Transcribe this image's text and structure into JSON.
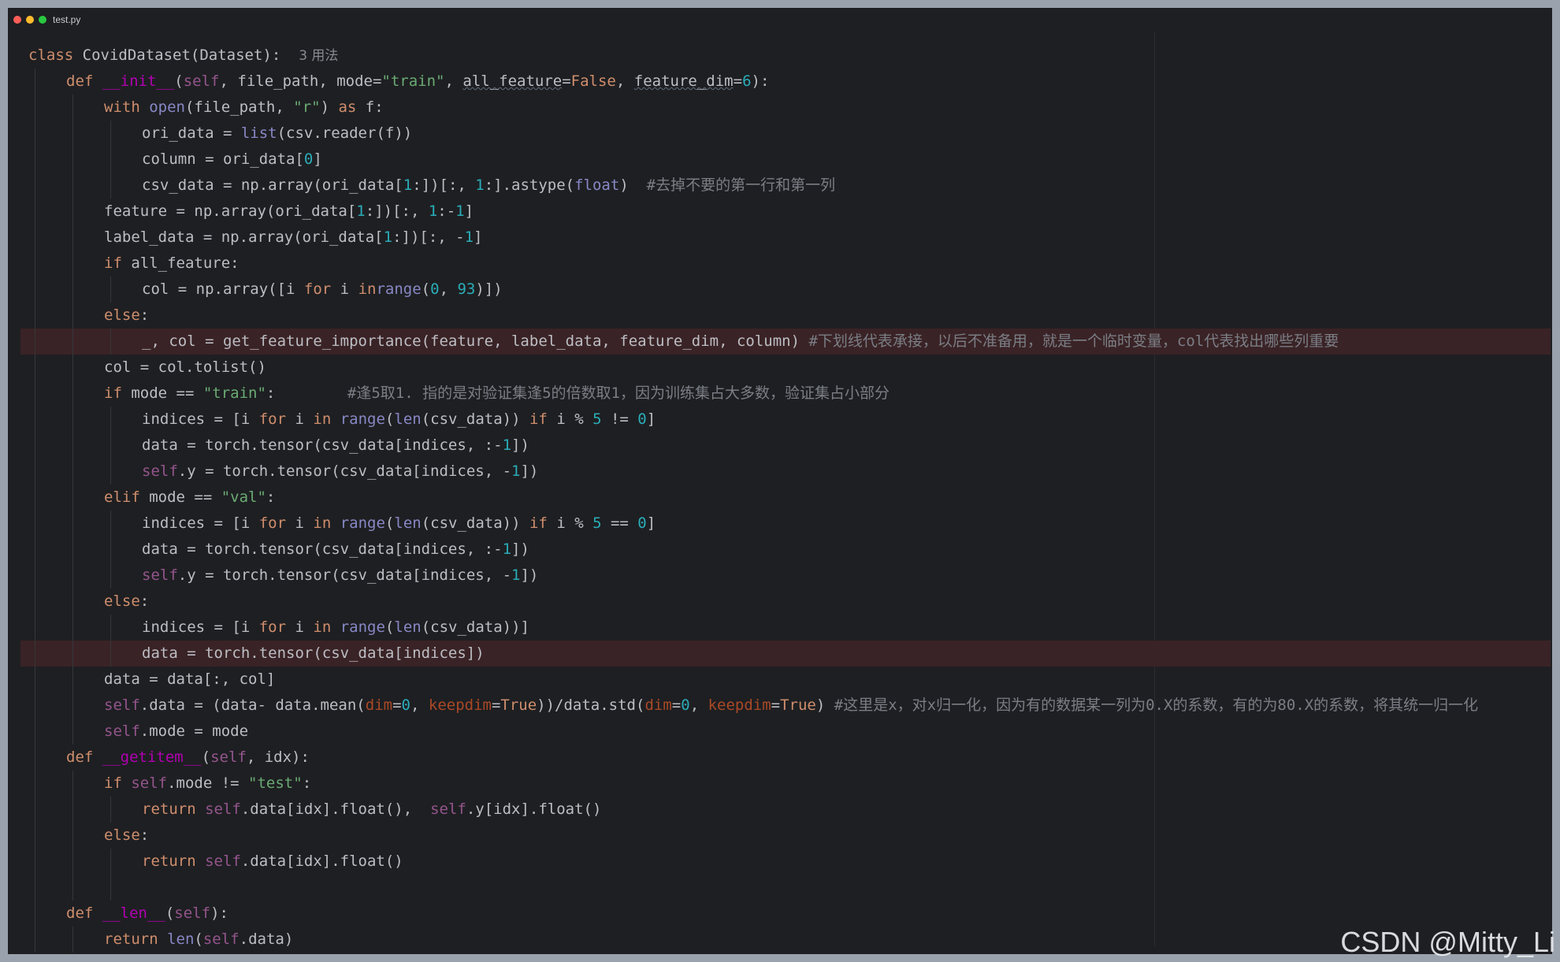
{
  "window": {
    "title": "test.py",
    "traffic_lights": [
      "#ff5f57",
      "#febc2e",
      "#28c840"
    ]
  },
  "watermark": "CSDN @Mitty_Li",
  "colors": {
    "background": "#1e1f22",
    "keyword": "#cf8e6d",
    "string": "#6aab73",
    "number": "#2aacb8",
    "function": "#56a8f5",
    "dunder": "#b200b2",
    "self": "#94558d",
    "builtin": "#8888c6",
    "named_arg": "#aa4926",
    "comment": "#7a7e85",
    "highlight_line": "#3a2326"
  },
  "code": {
    "lines": [
      {
        "indent": 0,
        "hl": false,
        "tokens": [
          [
            "kw",
            "class"
          ],
          [
            "",
            " CovidDataset(Dataset):  "
          ],
          [
            "hint",
            "3 用法"
          ]
        ]
      },
      {
        "indent": 1,
        "hl": false,
        "tokens": [
          [
            "kw",
            "def "
          ],
          [
            "dunder",
            "__init__"
          ],
          [
            "",
            "("
          ],
          [
            "self",
            "self"
          ],
          [
            "",
            ", file_path, mode="
          ],
          [
            "str",
            "\"train\""
          ],
          [
            "",
            ", "
          ],
          [
            "und",
            "all_feature"
          ],
          [
            "",
            "="
          ],
          [
            "kw",
            "False"
          ],
          [
            "",
            ", "
          ],
          [
            "und",
            "feature_dim"
          ],
          [
            "",
            "="
          ],
          [
            "num",
            "6"
          ],
          [
            "",
            "):"
          ]
        ]
      },
      {
        "indent": 2,
        "hl": false,
        "tokens": [
          [
            "kw",
            "with "
          ],
          [
            "bi",
            "open"
          ],
          [
            "",
            "(file_path, "
          ],
          [
            "str",
            "\"r\""
          ],
          [
            "",
            ") "
          ],
          [
            "kw",
            "as"
          ],
          [
            "",
            " f:"
          ]
        ]
      },
      {
        "indent": 3,
        "hl": false,
        "tokens": [
          [
            "",
            "ori_data = "
          ],
          [
            "bi",
            "list"
          ],
          [
            "",
            "(csv.reader(f))"
          ]
        ]
      },
      {
        "indent": 3,
        "hl": false,
        "tokens": [
          [
            "",
            "column = ori_data["
          ],
          [
            "num",
            "0"
          ],
          [
            "",
            "]"
          ]
        ]
      },
      {
        "indent": 3,
        "hl": false,
        "tokens": [
          [
            "",
            "csv_data = np.array(ori_data["
          ],
          [
            "num",
            "1"
          ],
          [
            "",
            ":])[:, "
          ],
          [
            "num",
            "1"
          ],
          [
            "",
            ":].astype("
          ],
          [
            "bi",
            "float"
          ],
          [
            "",
            ")  "
          ],
          [
            "cmt",
            "#去掉不要的第一行和第一列"
          ]
        ]
      },
      {
        "indent": 2,
        "hl": false,
        "tokens": [
          [
            "",
            "feature = np.array(ori_data["
          ],
          [
            "num",
            "1"
          ],
          [
            "",
            ":])[:, "
          ],
          [
            "num",
            "1"
          ],
          [
            "",
            ":-"
          ],
          [
            "num",
            "1"
          ],
          [
            "",
            "]"
          ]
        ]
      },
      {
        "indent": 2,
        "hl": false,
        "tokens": [
          [
            "",
            "label_data = np.array(ori_data["
          ],
          [
            "num",
            "1"
          ],
          [
            "",
            ":])[:, -"
          ],
          [
            "num",
            "1"
          ],
          [
            "",
            "]"
          ]
        ]
      },
      {
        "indent": 2,
        "hl": false,
        "tokens": [
          [
            "kw",
            "if"
          ],
          [
            "",
            " all_feature:"
          ]
        ]
      },
      {
        "indent": 3,
        "hl": false,
        "tokens": [
          [
            "",
            "col = np.array([i "
          ],
          [
            "kw",
            "for"
          ],
          [
            "",
            " i "
          ],
          [
            "kw",
            "in"
          ],
          [
            " ",
            ""
          ],
          [
            "bi",
            "range"
          ],
          [
            "",
            "("
          ],
          [
            "num",
            "0"
          ],
          [
            "",
            ", "
          ],
          [
            "num",
            "93"
          ],
          [
            "",
            ")])"
          ]
        ]
      },
      {
        "indent": 2,
        "hl": false,
        "tokens": [
          [
            "kw",
            "else"
          ],
          [
            "",
            ":"
          ]
        ]
      },
      {
        "indent": 3,
        "hl": true,
        "tokens": [
          [
            "",
            "_, col = get_feature_importance(feature, label_data, feature_dim, column) "
          ],
          [
            "cmt",
            "#下划线代表承接，以后不准备用，就是一个临时变量，col代表找出哪些列重要"
          ]
        ]
      },
      {
        "indent": 2,
        "hl": false,
        "tokens": [
          [
            "",
            "col = col.tolist()"
          ]
        ]
      },
      {
        "indent": 2,
        "hl": false,
        "tokens": [
          [
            "kw",
            "if"
          ],
          [
            "",
            " mode == "
          ],
          [
            "str",
            "\"train\""
          ],
          [
            "",
            ":        "
          ],
          [
            "cmt",
            "#逢5取1. 指的是对验证集逢5的倍数取1，因为训练集占大多数，验证集占小部分"
          ]
        ]
      },
      {
        "indent": 3,
        "hl": false,
        "tokens": [
          [
            "",
            "indices = [i "
          ],
          [
            "kw",
            "for"
          ],
          [
            "",
            " i "
          ],
          [
            "kw",
            "in"
          ],
          [
            "",
            " "
          ],
          [
            "bi",
            "range"
          ],
          [
            "",
            "("
          ],
          [
            "bi",
            "len"
          ],
          [
            "",
            "(csv_data)) "
          ],
          [
            "kw",
            "if"
          ],
          [
            "",
            " i % "
          ],
          [
            "num",
            "5"
          ],
          [
            "",
            ""
          ],
          [
            "",
            " != "
          ],
          [
            "num",
            "0"
          ],
          [
            "",
            "]"
          ]
        ]
      },
      {
        "indent": 3,
        "hl": false,
        "tokens": [
          [
            "",
            "data = torch.tensor(csv_data[indices, :-"
          ],
          [
            "num",
            "1"
          ],
          [
            "",
            "])"
          ]
        ]
      },
      {
        "indent": 3,
        "hl": false,
        "tokens": [
          [
            "self",
            "self"
          ],
          [
            "",
            ".y = torch.tensor(csv_data[indices, -"
          ],
          [
            "num",
            "1"
          ],
          [
            "",
            "])"
          ]
        ]
      },
      {
        "indent": 2,
        "hl": false,
        "tokens": [
          [
            "kw",
            "elif"
          ],
          [
            "",
            " mode == "
          ],
          [
            "str",
            "\"val\""
          ],
          [
            "",
            ":"
          ]
        ]
      },
      {
        "indent": 3,
        "hl": false,
        "tokens": [
          [
            "",
            "indices = [i "
          ],
          [
            "kw",
            "for"
          ],
          [
            "",
            " i "
          ],
          [
            "kw",
            "in"
          ],
          [
            "",
            " "
          ],
          [
            "bi",
            "range"
          ],
          [
            "",
            "("
          ],
          [
            "bi",
            "len"
          ],
          [
            "",
            "(csv_data)) "
          ],
          [
            "kw",
            "if"
          ],
          [
            "",
            " i % "
          ],
          [
            "num",
            "5"
          ],
          [
            "",
            " == "
          ],
          [
            "num",
            "0"
          ],
          [
            "",
            "]"
          ]
        ]
      },
      {
        "indent": 3,
        "hl": false,
        "tokens": [
          [
            "",
            "data = torch.tensor(csv_data[indices, :-"
          ],
          [
            "num",
            "1"
          ],
          [
            "",
            "])"
          ]
        ]
      },
      {
        "indent": 3,
        "hl": false,
        "tokens": [
          [
            "self",
            "self"
          ],
          [
            "",
            ".y = torch.tensor(csv_data[indices, -"
          ],
          [
            "num",
            "1"
          ],
          [
            "",
            "])"
          ]
        ]
      },
      {
        "indent": 2,
        "hl": false,
        "tokens": [
          [
            "kw",
            "else"
          ],
          [
            "",
            ":"
          ]
        ]
      },
      {
        "indent": 3,
        "hl": false,
        "tokens": [
          [
            "",
            "indices = [i "
          ],
          [
            "kw",
            "for"
          ],
          [
            "",
            " i "
          ],
          [
            "kw",
            "in"
          ],
          [
            "",
            " "
          ],
          [
            "bi",
            "range"
          ],
          [
            "",
            "("
          ],
          [
            "bi",
            "len"
          ],
          [
            "",
            "(csv_data))]"
          ]
        ]
      },
      {
        "indent": 3,
        "hl": true,
        "tokens": [
          [
            "",
            "data = torch.tensor(csv_data[indices])"
          ]
        ]
      },
      {
        "indent": 2,
        "hl": false,
        "tokens": [
          [
            "",
            "data = data[:, col]"
          ]
        ]
      },
      {
        "indent": 2,
        "hl": false,
        "tokens": [
          [
            "self",
            "self"
          ],
          [
            "",
            ".data = (data- data.mean("
          ],
          [
            "param",
            "dim"
          ],
          [
            "",
            "="
          ],
          [
            "num",
            "0"
          ],
          [
            "",
            ", "
          ],
          [
            "param",
            "keepdim"
          ],
          [
            "",
            "="
          ],
          [
            "kw",
            "True"
          ],
          [
            "",
            "))/data.std("
          ],
          [
            "param",
            "dim"
          ],
          [
            "",
            "="
          ],
          [
            "num",
            "0"
          ],
          [
            "",
            ", "
          ],
          [
            "param",
            "keepdim"
          ],
          [
            "",
            "="
          ],
          [
            "kw",
            "True"
          ],
          [
            "",
            ") "
          ],
          [
            "cmt",
            "#这里是x，对x归一化，因为有的数据某一列为0.X的系数，有的为80.X的系数，将其统一归一化"
          ]
        ]
      },
      {
        "indent": 2,
        "hl": false,
        "tokens": [
          [
            "self",
            "self"
          ],
          [
            "",
            ".mode = mode"
          ]
        ]
      },
      {
        "indent": 1,
        "hl": false,
        "tokens": [
          [
            "kw",
            "def "
          ],
          [
            "dunder",
            "__getitem__"
          ],
          [
            "",
            "("
          ],
          [
            "self",
            "self"
          ],
          [
            "",
            ", idx):"
          ]
        ]
      },
      {
        "indent": 2,
        "hl": false,
        "tokens": [
          [
            "kw",
            "if "
          ],
          [
            "self",
            "self"
          ],
          [
            "",
            ".mode != "
          ],
          [
            "str",
            "\"test\""
          ],
          [
            "",
            ":"
          ]
        ]
      },
      {
        "indent": 3,
        "hl": false,
        "tokens": [
          [
            "kw",
            "return "
          ],
          [
            "self",
            "self"
          ],
          [
            "",
            ".data[idx].float(),  "
          ],
          [
            "self",
            "self"
          ],
          [
            "",
            ".y[idx].float()"
          ]
        ]
      },
      {
        "indent": 2,
        "hl": false,
        "tokens": [
          [
            "kw",
            "else"
          ],
          [
            "",
            ":"
          ]
        ]
      },
      {
        "indent": 3,
        "hl": false,
        "tokens": [
          [
            "kw",
            "return "
          ],
          [
            "self",
            "self"
          ],
          [
            "",
            ".data[idx].float()"
          ]
        ]
      },
      {
        "indent": 0,
        "hl": false,
        "tokens": []
      },
      {
        "indent": 1,
        "hl": false,
        "tokens": [
          [
            "kw",
            "def "
          ],
          [
            "dunder",
            "__len__"
          ],
          [
            "",
            "("
          ],
          [
            "self",
            "self"
          ],
          [
            "",
            "):"
          ]
        ]
      },
      {
        "indent": 2,
        "hl": false,
        "tokens": [
          [
            "kw",
            "return "
          ],
          [
            "bi",
            "len"
          ],
          [
            "",
            "("
          ],
          [
            "self",
            "self"
          ],
          [
            "",
            ".data)"
          ]
        ]
      }
    ]
  }
}
